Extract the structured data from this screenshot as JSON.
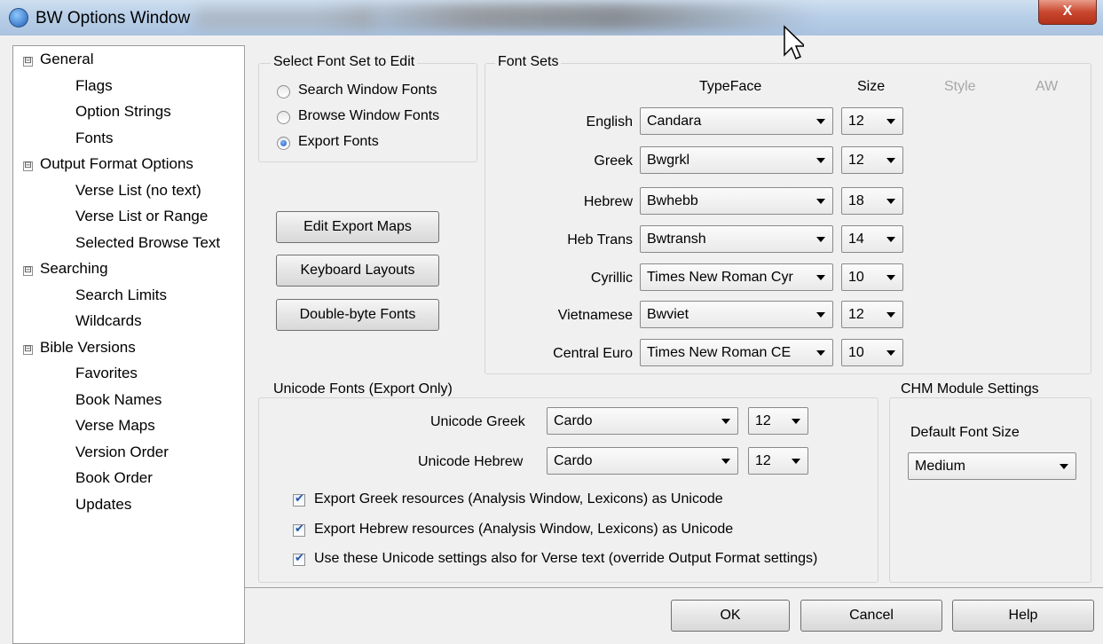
{
  "window": {
    "title": "BW Options Window",
    "close_label": "X"
  },
  "tree": [
    {
      "label": "General",
      "level": 0,
      "expander": "⊟"
    },
    {
      "label": "Flags",
      "level": 1
    },
    {
      "label": "Option Strings",
      "level": 1
    },
    {
      "label": "Fonts",
      "level": 1
    },
    {
      "label": "Output Format Options",
      "level": 0,
      "expander": "⊟"
    },
    {
      "label": "Verse List (no text)",
      "level": 1
    },
    {
      "label": "Verse List or Range",
      "level": 1
    },
    {
      "label": "Selected Browse Text",
      "level": 1
    },
    {
      "label": "Searching",
      "level": 0,
      "expander": "⊟"
    },
    {
      "label": "Search Limits",
      "level": 1
    },
    {
      "label": "Wildcards",
      "level": 1
    },
    {
      "label": "Bible Versions",
      "level": 0,
      "expander": "⊟"
    },
    {
      "label": "Favorites",
      "level": 1
    },
    {
      "label": "Book Names",
      "level": 1
    },
    {
      "label": "Verse Maps",
      "level": 1
    },
    {
      "label": "Version Order",
      "level": 1
    },
    {
      "label": "Book Order",
      "level": 1
    },
    {
      "label": "Updates",
      "level": 1
    }
  ],
  "font_set_select": {
    "legend": "Select Font Set to Edit",
    "options": [
      {
        "label": "Search Window Fonts",
        "selected": false
      },
      {
        "label": "Browse Window Fonts",
        "selected": false
      },
      {
        "label": "Export Fonts",
        "selected": true
      }
    ]
  },
  "buttons": {
    "edit_export_maps": "Edit Export Maps",
    "keyboard_layouts": "Keyboard Layouts",
    "double_byte_fonts": "Double-byte Fonts",
    "ok": "OK",
    "cancel": "Cancel",
    "help": "Help"
  },
  "font_sets": {
    "legend": "Font Sets",
    "headers": {
      "typeface": "TypeFace",
      "size": "Size",
      "style": "Style",
      "aw": "AW"
    },
    "rows": [
      {
        "label": "English",
        "typeface": "Candara",
        "size": "12"
      },
      {
        "label": "Greek",
        "typeface": "Bwgrkl",
        "size": "12"
      },
      {
        "label": "Hebrew",
        "typeface": "Bwhebb",
        "size": "18"
      },
      {
        "label": "Heb Trans",
        "typeface": "Bwtransh",
        "size": "14"
      },
      {
        "label": "Cyrillic",
        "typeface": "Times New Roman Cyr",
        "size": "10"
      },
      {
        "label": "Vietnamese",
        "typeface": "Bwviet",
        "size": "12"
      },
      {
        "label": "Central Euro",
        "typeface": "Times New Roman CE",
        "size": "10"
      }
    ]
  },
  "unicode": {
    "legend": "Unicode Fonts (Export Only)",
    "greek_label": "Unicode Greek",
    "greek_font": "Cardo",
    "greek_size": "12",
    "hebrew_label": "Unicode Hebrew",
    "hebrew_font": "Cardo",
    "hebrew_size": "12",
    "checks": [
      {
        "label": "Export Greek resources (Analysis Window, Lexicons) as Unicode",
        "checked": true
      },
      {
        "label": "Export Hebrew resources (Analysis Window, Lexicons) as Unicode",
        "checked": true
      },
      {
        "label": "Use these Unicode settings also for Verse text (override Output Format settings)",
        "checked": true
      }
    ]
  },
  "chm": {
    "legend": "CHM Module Settings",
    "default_font_size_label": "Default Font Size",
    "default_font_size_value": "Medium"
  }
}
